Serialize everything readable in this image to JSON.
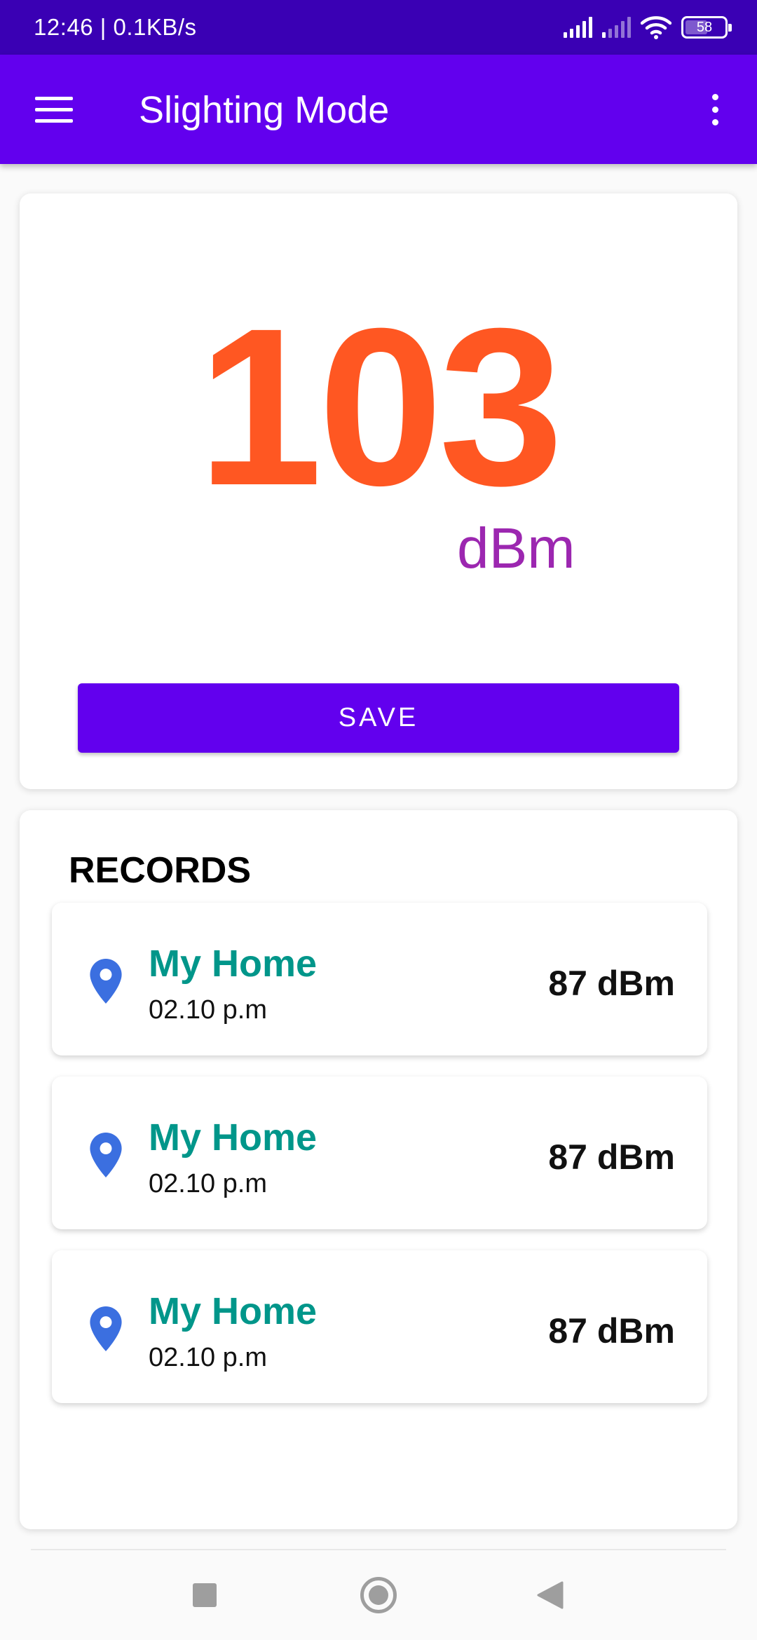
{
  "status_bar": {
    "time_speed": "12:46 | 0.1KB/s",
    "battery": "58",
    "battery_level": 0.58,
    "icons": [
      "signal-icon",
      "signal-icon",
      "wifi-icon",
      "battery-icon"
    ]
  },
  "app_bar": {
    "title": "Slighting Mode",
    "menu_icon": "hamburger-menu-icon",
    "overflow_icon": "more-vertical-icon",
    "color": "#6200ee"
  },
  "reading": {
    "value": "103",
    "unit": "dBm",
    "value_color": "#ff5722",
    "unit_color": "#9c27b0"
  },
  "save_button": {
    "label": "SAVE"
  },
  "records": {
    "title": "RECORDS",
    "items": [
      {
        "name": "My Home",
        "time": "02.10 p.m",
        "value": "87 dBm",
        "icon": "location-pin-icon"
      },
      {
        "name": "My Home",
        "time": "02.10 p.m",
        "value": "87 dBm",
        "icon": "location-pin-icon"
      },
      {
        "name": "My Home",
        "time": "02.10 p.m",
        "value": "87 dBm",
        "icon": "location-pin-icon"
      }
    ]
  },
  "nav_bar": {
    "icons": [
      "recents-square-icon",
      "home-circle-icon",
      "back-triangle-icon"
    ]
  }
}
